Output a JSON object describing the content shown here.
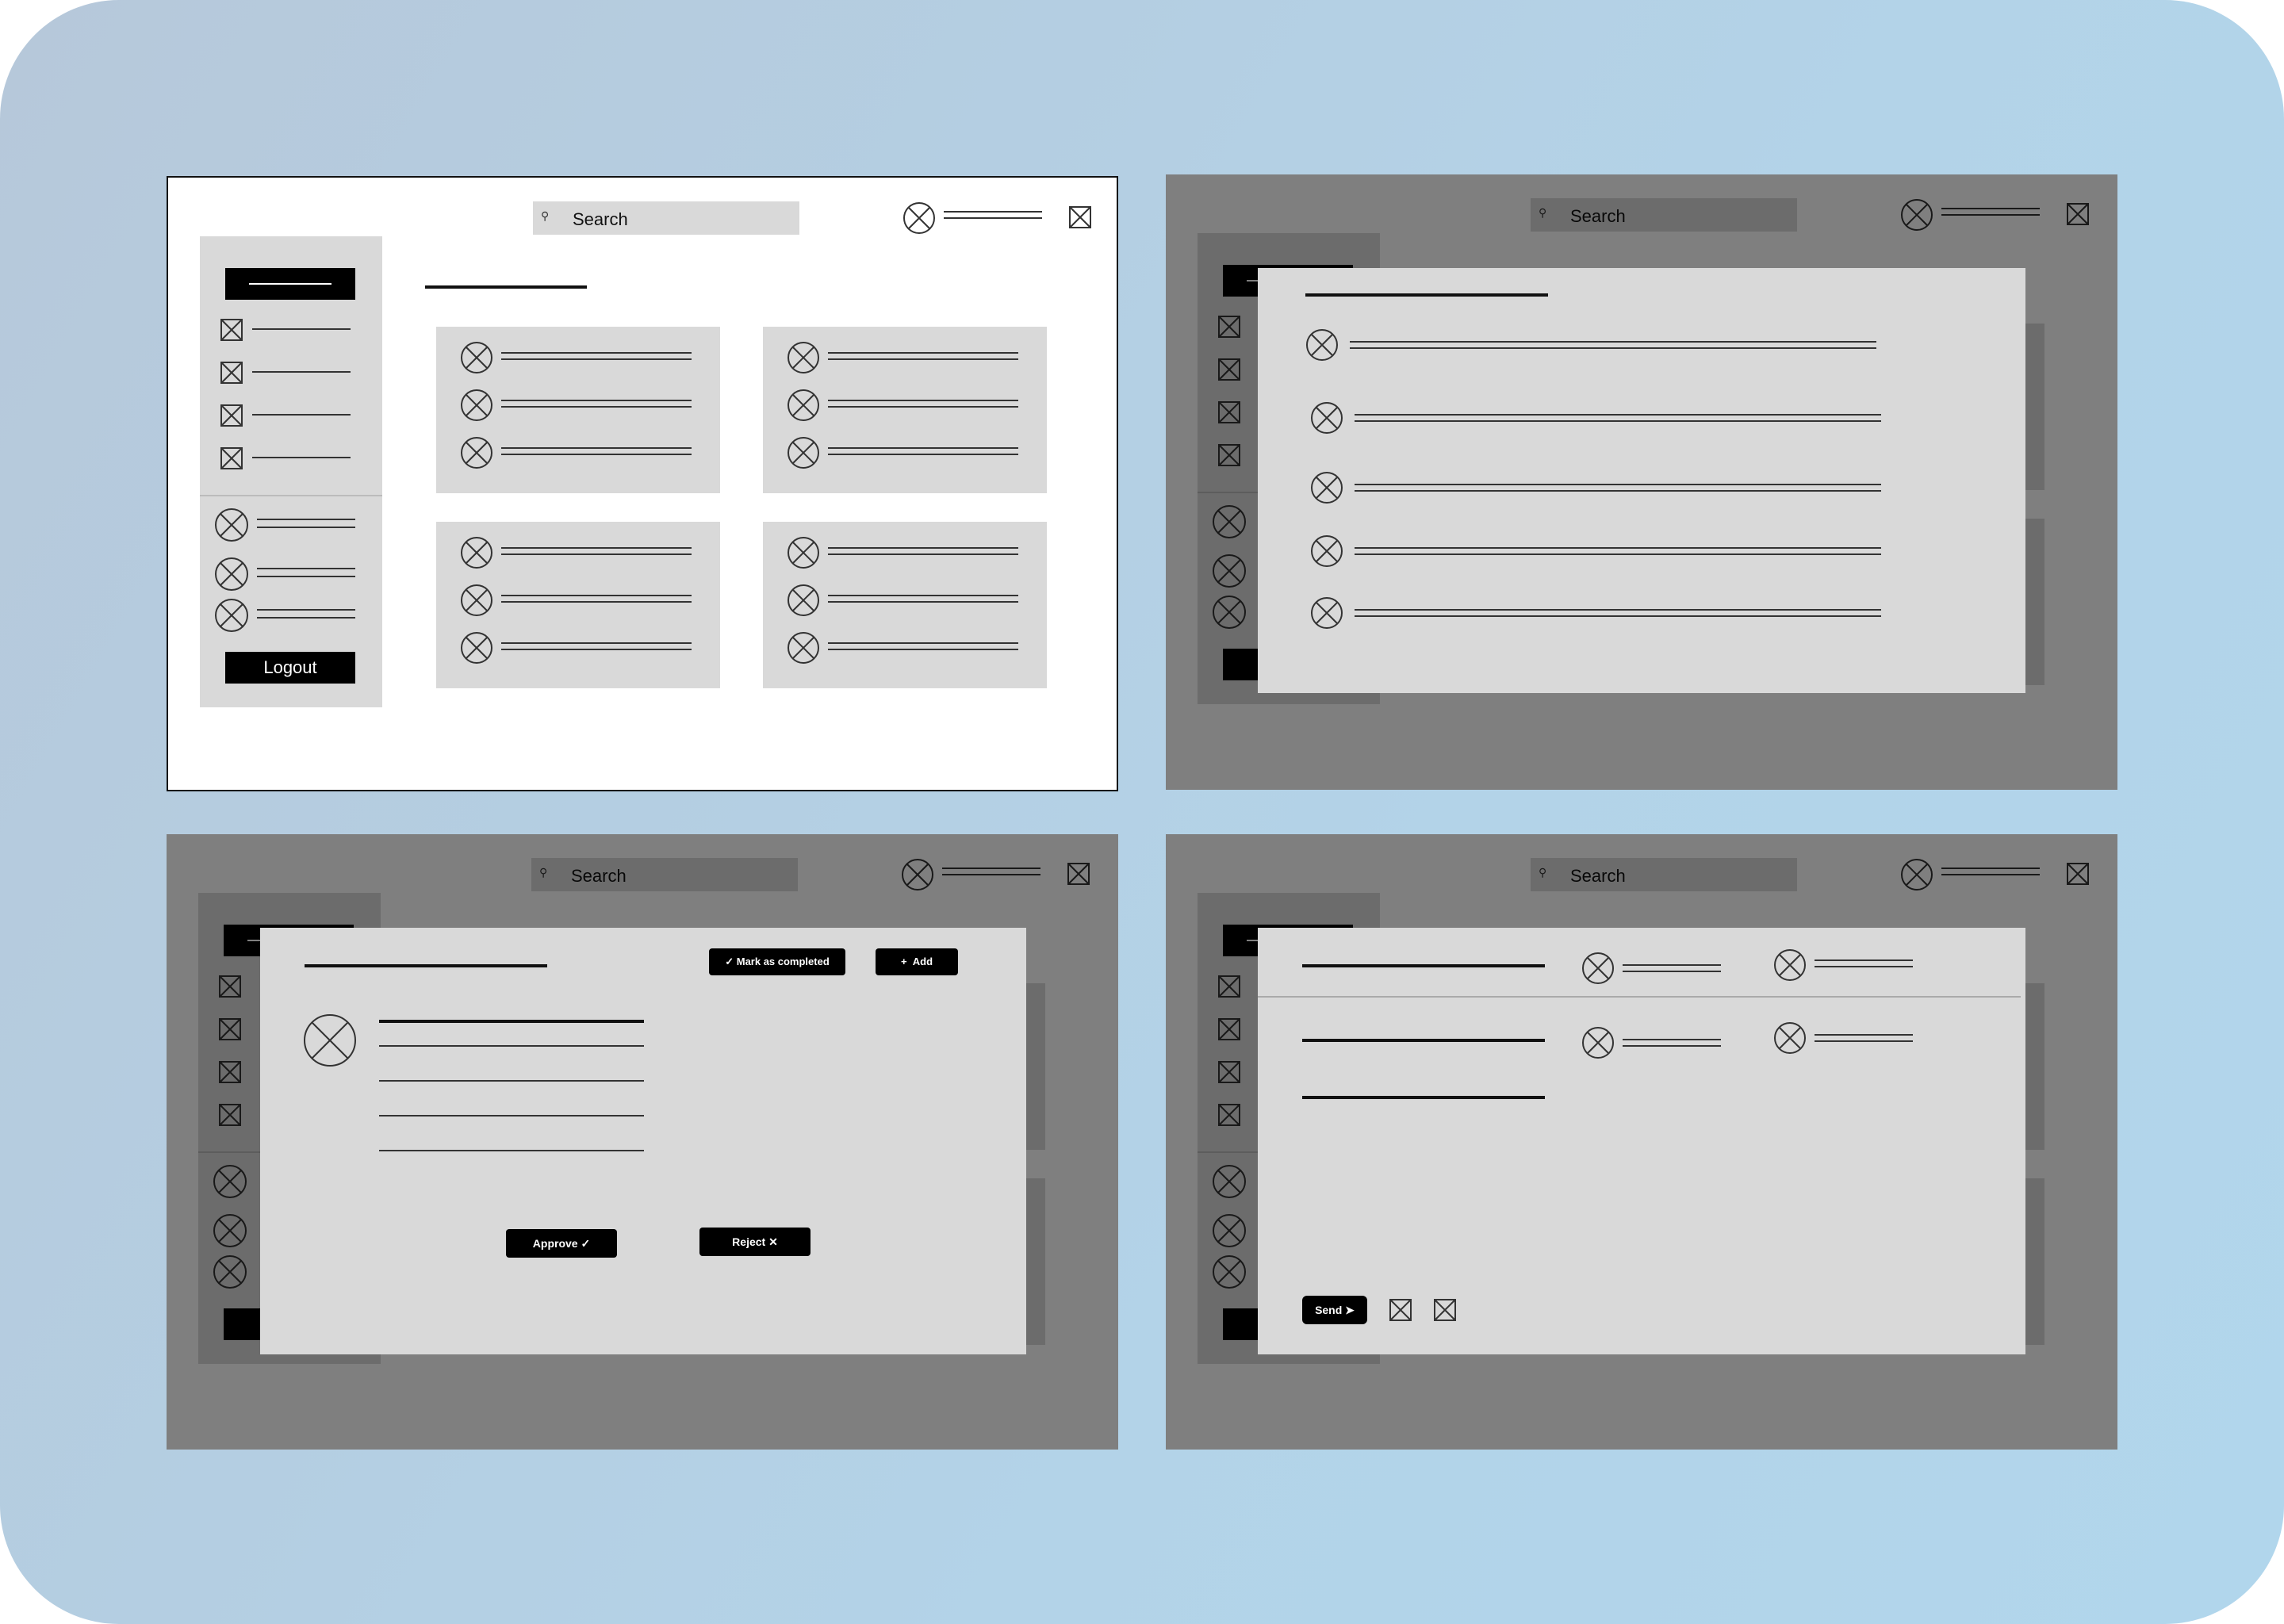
{
  "shell": {
    "search_placeholder": "Search",
    "logout_label": "Logout"
  },
  "modal_approval": {
    "mark_completed_label": "Mark as completed",
    "add_label": "Add",
    "approve_label": "Approve",
    "reject_label": "Reject"
  },
  "modal_message": {
    "send_label": "Send"
  },
  "icons": {
    "search": "search-icon",
    "avatar": "avatar-placeholder-icon",
    "image": "image-placeholder-icon",
    "check": "check-icon",
    "plus": "plus-icon",
    "close": "close-icon",
    "send": "send-arrow-icon"
  },
  "colors": {
    "background_light": "#b4cfe4",
    "panel_gray": "#d9d9d9",
    "button_black": "#000000"
  }
}
